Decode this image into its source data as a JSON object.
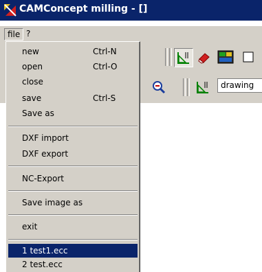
{
  "window": {
    "title": "CAMConcept milling - []"
  },
  "menubar": {
    "file_label": "file",
    "help_label": "?"
  },
  "file_menu": {
    "items": [
      {
        "label": "new",
        "shortcut": "Ctrl-N"
      },
      {
        "label": "open",
        "shortcut": "Ctrl-O"
      },
      {
        "label": "close",
        "shortcut": ""
      },
      {
        "label": "save",
        "shortcut": "Ctrl-S"
      },
      {
        "label": "Save as",
        "shortcut": ""
      },
      {
        "label": "DXF import",
        "shortcut": ""
      },
      {
        "label": "DXF export",
        "shortcut": ""
      },
      {
        "label": "NC-Export",
        "shortcut": ""
      },
      {
        "label": "Save image as",
        "shortcut": ""
      },
      {
        "label": "exit",
        "shortcut": ""
      },
      {
        "label": "1 test1.ecc",
        "shortcut": ""
      },
      {
        "label": "2 test.ecc",
        "shortcut": ""
      }
    ],
    "selected_item": "1 test1.ecc"
  },
  "toolbar": {
    "view_combo_value": "drawing"
  },
  "colors": {
    "titlebar": "#0a246a",
    "menu_bg": "#d4d0c8",
    "selection": "#0a246a"
  },
  "icons": [
    "app-icon",
    "grid-snap-icon",
    "eraser-icon",
    "cnc-display-icon",
    "zoom-out-icon",
    "ruler-icon"
  ]
}
